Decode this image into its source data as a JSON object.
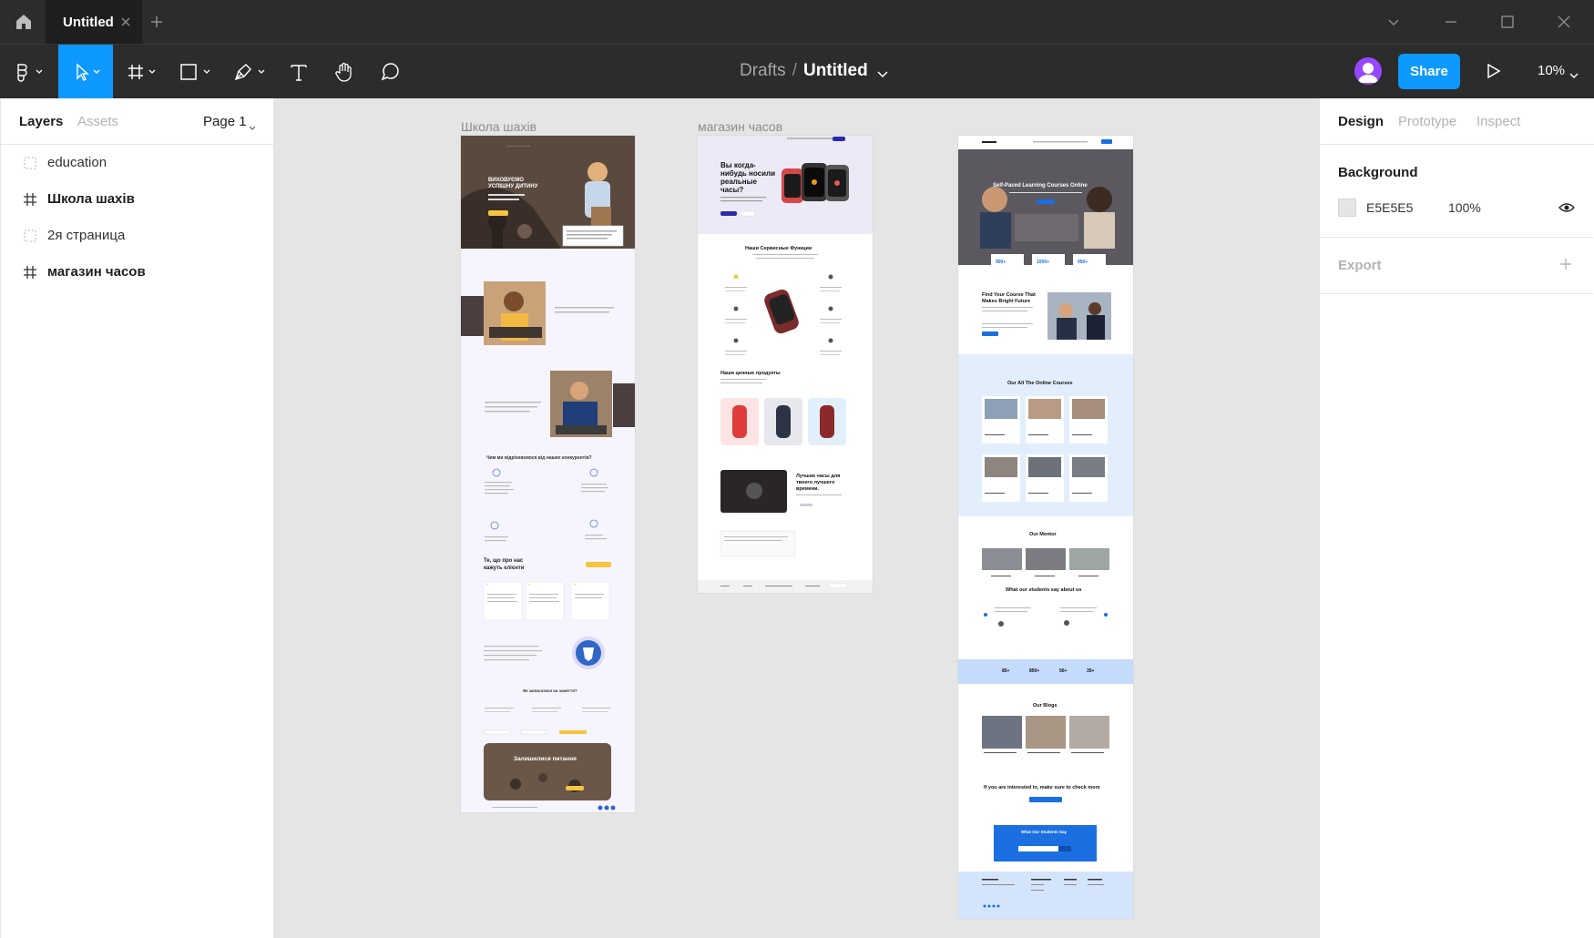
{
  "titlebar": {
    "tab_title": "Untitled"
  },
  "toolbar": {
    "breadcrumb_path": "Drafts",
    "breadcrumb_sep": "/",
    "file_name": "Untitled",
    "share_label": "Share",
    "zoom": "10%",
    "accent": "#0d99ff"
  },
  "left_panel": {
    "tabs": [
      "Layers",
      "Assets"
    ],
    "page": "Page 1",
    "layers": [
      {
        "label": "education",
        "icon": "section-icon"
      },
      {
        "label": "Школа шахів",
        "icon": "frame-icon"
      },
      {
        "label": "2я страница",
        "icon": "section-icon"
      },
      {
        "label": "магазин часов",
        "icon": "frame-icon"
      }
    ]
  },
  "canvas": {
    "background": "#E5E5E5",
    "frames": [
      {
        "label": "Школа шахів"
      },
      {
        "label": "магазин часов"
      }
    ],
    "chess": {
      "hero_title": "Виховуємо успішну дитину",
      "diff_title": "Чим ми відрізняємося від наших конкурентів?",
      "reviews_title": "Те, що про нас кажуть клієнти",
      "enroll_title": "Як записатися на заняття?",
      "questions_title": "Залишилися питання"
    },
    "watches": {
      "hero_title": "Вы когда-нибудь носили реальные часы?",
      "services_title": "Наши Сервисные Функции",
      "products_title": "Наши ценные продукты",
      "best_title": "Лучшие часы для твоего лучшего времени."
    },
    "education": {
      "hero_title": "Self-Paced Learning Courses Online",
      "course_title": "Find Your Course That Makes Bright Future",
      "courses_title": "Our All The Online Courses",
      "mentor_title": "Our Mentor",
      "students_title": "What our students say about us",
      "stats": [
        "85+",
        "850+",
        "56+",
        "35+"
      ],
      "blogs_title": "Our Blogs",
      "interest_title": "If you are interested in, make sure to check more",
      "box_title": "What Our Students Say"
    }
  },
  "right_panel": {
    "tabs": [
      "Design",
      "Prototype",
      "Inspect"
    ],
    "background_title": "Background",
    "bg_hex": "E5E5E5",
    "bg_opacity": "100%",
    "export_title": "Export"
  }
}
